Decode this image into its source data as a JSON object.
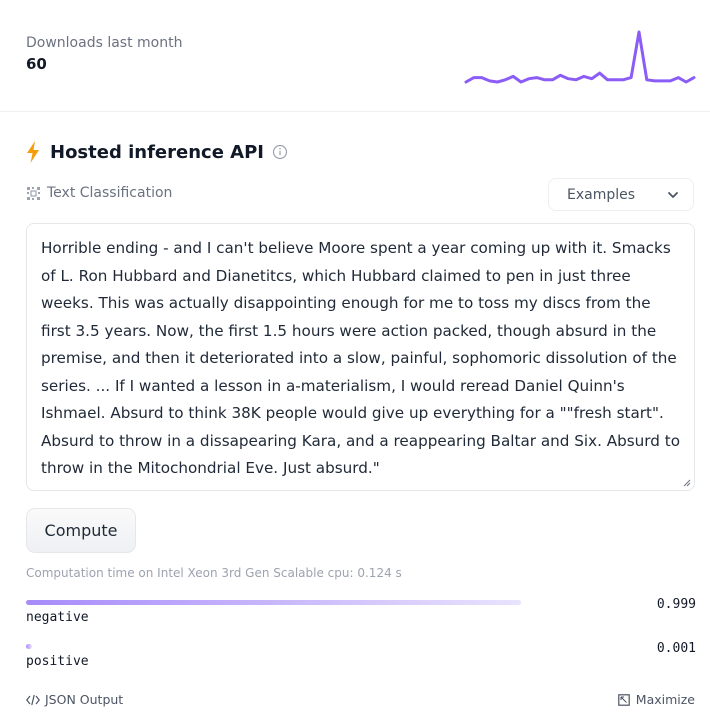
{
  "downloads": {
    "label": "Downloads last month",
    "value": "60"
  },
  "sparkline": {
    "values": [
      3,
      7,
      7,
      4,
      3,
      5,
      8,
      3,
      6,
      7,
      5,
      5,
      9,
      6,
      5,
      8,
      6,
      11,
      5,
      5,
      5,
      7,
      48,
      5,
      4,
      4,
      4,
      7,
      3,
      7
    ],
    "color": "#8b5cf6"
  },
  "api": {
    "title": "Hosted inference API",
    "accent": "#f59e0b"
  },
  "task": {
    "label": "Text Classification",
    "examples_label": "Examples"
  },
  "input": {
    "value": "Horrible ending - and I can't believe Moore spent a year coming up with it. Smacks of L. Ron Hubbard and Dianetitcs, which Hubbard claimed to pen in just three weeks. This was actually disappointing enough for me to toss my discs from the first 3.5 years. Now, the first 1.5 hours were action packed, though absurd in the premise, and then it deteriorated into a slow, painful, sophomoric dissolution of the series. ... If I wanted a lesson in a-materialism, I would reread Daniel Quinn's Ishmael. Absurd to think 38K people would give up everything for a \"\"fresh start\". Absurd to throw in a dissapearing Kara, and a reappearing Baltar and Six. Absurd to throw in the Mitochondrial Eve. Just absurd.\""
  },
  "compute": {
    "label": "Compute"
  },
  "computation_time": "Computation time on Intel Xeon 3rd Gen Scalable cpu: 0.124 s",
  "results": [
    {
      "label": "negative",
      "score": "0.999",
      "fraction": 0.999
    },
    {
      "label": "positive",
      "score": "0.001",
      "fraction": 0.012
    }
  ],
  "footer": {
    "json_label": "JSON Output",
    "maximize_label": "Maximize"
  }
}
